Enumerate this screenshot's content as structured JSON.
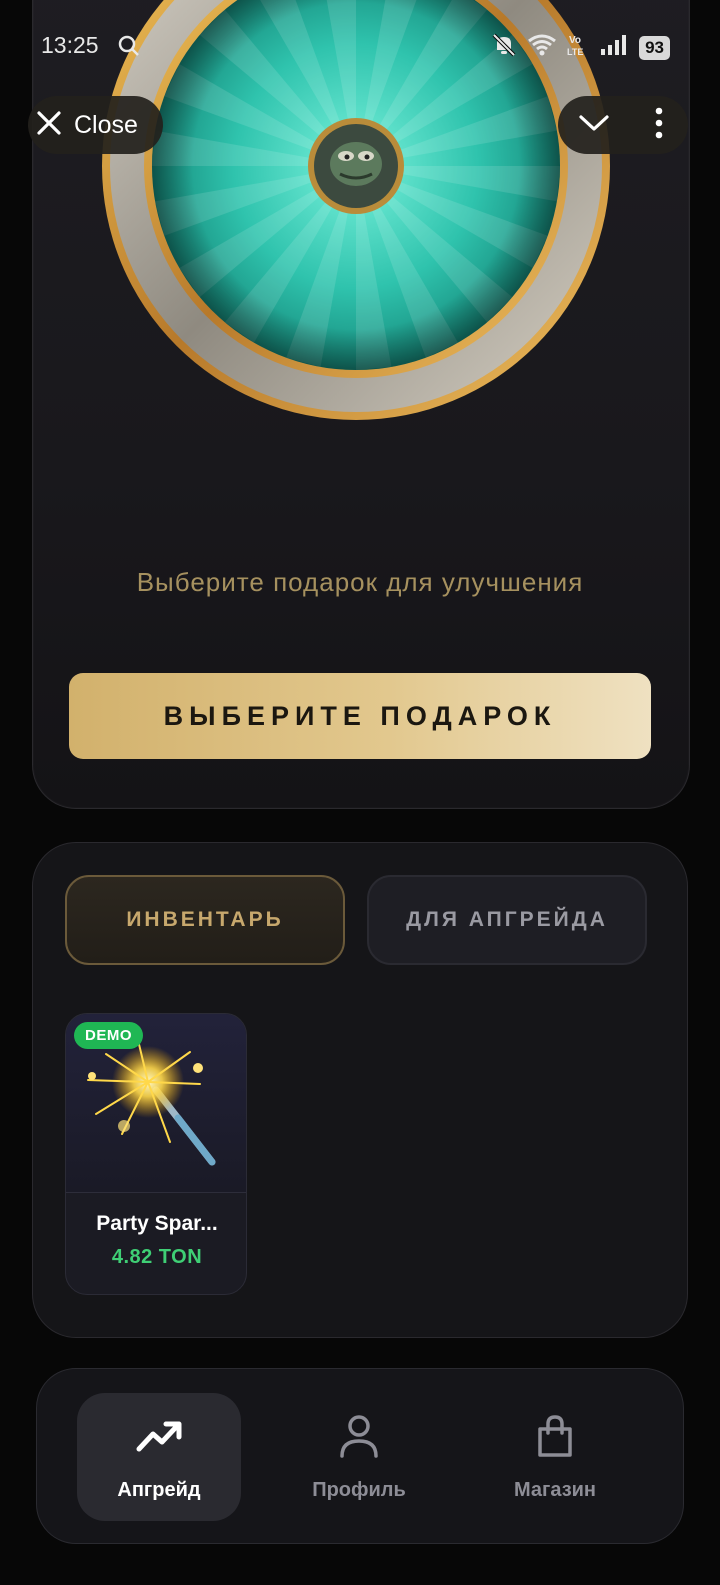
{
  "status_bar": {
    "time": "13:25",
    "battery": "93",
    "icons": [
      "search-icon",
      "mute-icon",
      "wifi-icon",
      "volte-icon",
      "signal-icon",
      "battery-icon"
    ]
  },
  "header": {
    "close_label": "Close"
  },
  "upgrade": {
    "subtitle": "Выберите подарок для улучшения",
    "cta_label": "ВЫБЕРИТЕ ПОДАРОК"
  },
  "inventory": {
    "tabs": [
      {
        "label": "ИНВЕНТАРЬ",
        "active": true
      },
      {
        "label": "ДЛЯ АПГРЕЙДА",
        "active": false
      }
    ],
    "items": [
      {
        "badge": "DEMO",
        "name": "Party Spar...",
        "price": "4.82 TON",
        "icon": "sparkler-icon"
      }
    ]
  },
  "nav": {
    "items": [
      {
        "label": "Апгрейд",
        "icon": "trending-up-icon",
        "active": true
      },
      {
        "label": "Профиль",
        "icon": "user-icon",
        "active": false
      },
      {
        "label": "Магазин",
        "icon": "shopping-bag-icon",
        "active": false
      }
    ]
  },
  "colors": {
    "background": "#070707",
    "accent_gold": "#d2b16c",
    "wheel_teal": "#2fc3ad",
    "price_green": "#3fcf75",
    "demo_badge": "#1fb754"
  }
}
